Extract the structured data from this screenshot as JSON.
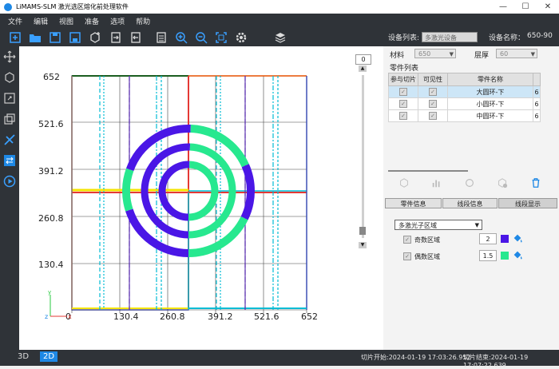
{
  "window": {
    "title": "LiMAMS-SLM 激光选区熔化前处理软件",
    "minimize": "—",
    "maximize": "☐",
    "close": "✕"
  },
  "menu": [
    "文件",
    "编辑",
    "视图",
    "准备",
    "选项",
    "帮助"
  ],
  "device": {
    "list_label": "设备列表:",
    "selected": "多激光设备",
    "name_label": "设备名称：",
    "name_value": "650-90"
  },
  "canvas": {
    "y_labels": [
      "652",
      "521.6",
      "391.2",
      "260.8",
      "130.4"
    ],
    "x_labels": [
      "0",
      "130.4",
      "260.8",
      "391.2",
      "521.6",
      "652"
    ],
    "origin": "0",
    "axis_x": "x",
    "axis_y": "y",
    "axis_z": "z",
    "slider_value": "0",
    "colors": {
      "odd": "#4a16e6",
      "even": "#27e88f"
    }
  },
  "panel": {
    "material_label": "材料",
    "material_value": "650",
    "layer_label": "层厚",
    "layer_value": "60",
    "parts_list_label": "零件列表",
    "columns": [
      "参与切片",
      "可见性",
      "零件名称",
      ""
    ],
    "parts": [
      {
        "name": "大圆环-下",
        "extra": "6"
      },
      {
        "name": "小圆环-下",
        "extra": "6"
      },
      {
        "name": "中圆环-下",
        "extra": "6"
      }
    ],
    "tabs": [
      "零件信息",
      "线段信息",
      "线段显示"
    ],
    "region_mode": "多激光子区域",
    "odd_label": "奇数区域",
    "odd_value": "2",
    "even_label": "偶数区域",
    "even_value": "1.5"
  },
  "status": {
    "tab_3d": "3D",
    "tab_2d": "2D",
    "slice_start": "切片开始:2024-01-19 17:03:26.952",
    "slice_end": "切片结束:2024-01-19 17:07:22.639"
  },
  "icons": [
    "new-file-icon",
    "open-folder-icon",
    "save-icon",
    "save-as-icon",
    "add-part-icon",
    "import-icon",
    "export-icon",
    "slice-icon",
    "zoom-in-icon",
    "zoom-out-icon",
    "fit-view-icon",
    "settings-gear-icon",
    "layers-icon"
  ]
}
